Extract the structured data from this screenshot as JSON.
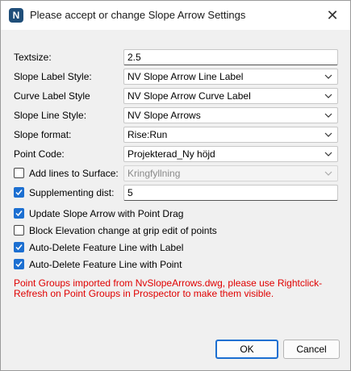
{
  "window": {
    "title": "Please accept or change Slope Arrow Settings",
    "app_icon_letter": "N",
    "close_glyph": "✕"
  },
  "form": {
    "textsize": {
      "label": "Textsize:",
      "value": "2.5"
    },
    "slope_label_style": {
      "label": "Slope Label Style:",
      "value": "NV Slope Arrow Line Label"
    },
    "curve_label_style": {
      "label": "Curve Label Style",
      "value": "NV Slope Arrow Curve Label"
    },
    "slope_line_style": {
      "label": "Slope Line Style:",
      "value": "NV Slope Arrows"
    },
    "slope_format": {
      "label": "Slope format:",
      "value": "Rise:Run"
    },
    "point_code": {
      "label": "Point Code:",
      "value": "Projekterad_Ny höjd"
    },
    "add_lines": {
      "label": "Add lines to Surface:",
      "checked": false,
      "value": "Kringfyllning",
      "disabled": true
    },
    "supplementing_dist": {
      "label": "Supplementing dist:",
      "checked": true,
      "value": "5"
    },
    "update_slope_arrow": {
      "label": "Update Slope Arrow with Point Drag",
      "checked": true
    },
    "block_elevation": {
      "label": "Block Elevation change at grip edit of points",
      "checked": false
    },
    "auto_delete_label": {
      "label": "Auto-Delete Feature Line with Label",
      "checked": true
    },
    "auto_delete_point": {
      "label": "Auto-Delete Feature Line with Point",
      "checked": true
    }
  },
  "note": "Point Groups imported from NvSlopeArrows.dwg, please use Rightclick-Refresh on Point Groups in Prospector to make them visible.",
  "buttons": {
    "ok": "OK",
    "cancel": "Cancel"
  },
  "colors": {
    "accent": "#1c6fd1",
    "note_text": "#e00000",
    "app_icon": "#1f4e79"
  }
}
